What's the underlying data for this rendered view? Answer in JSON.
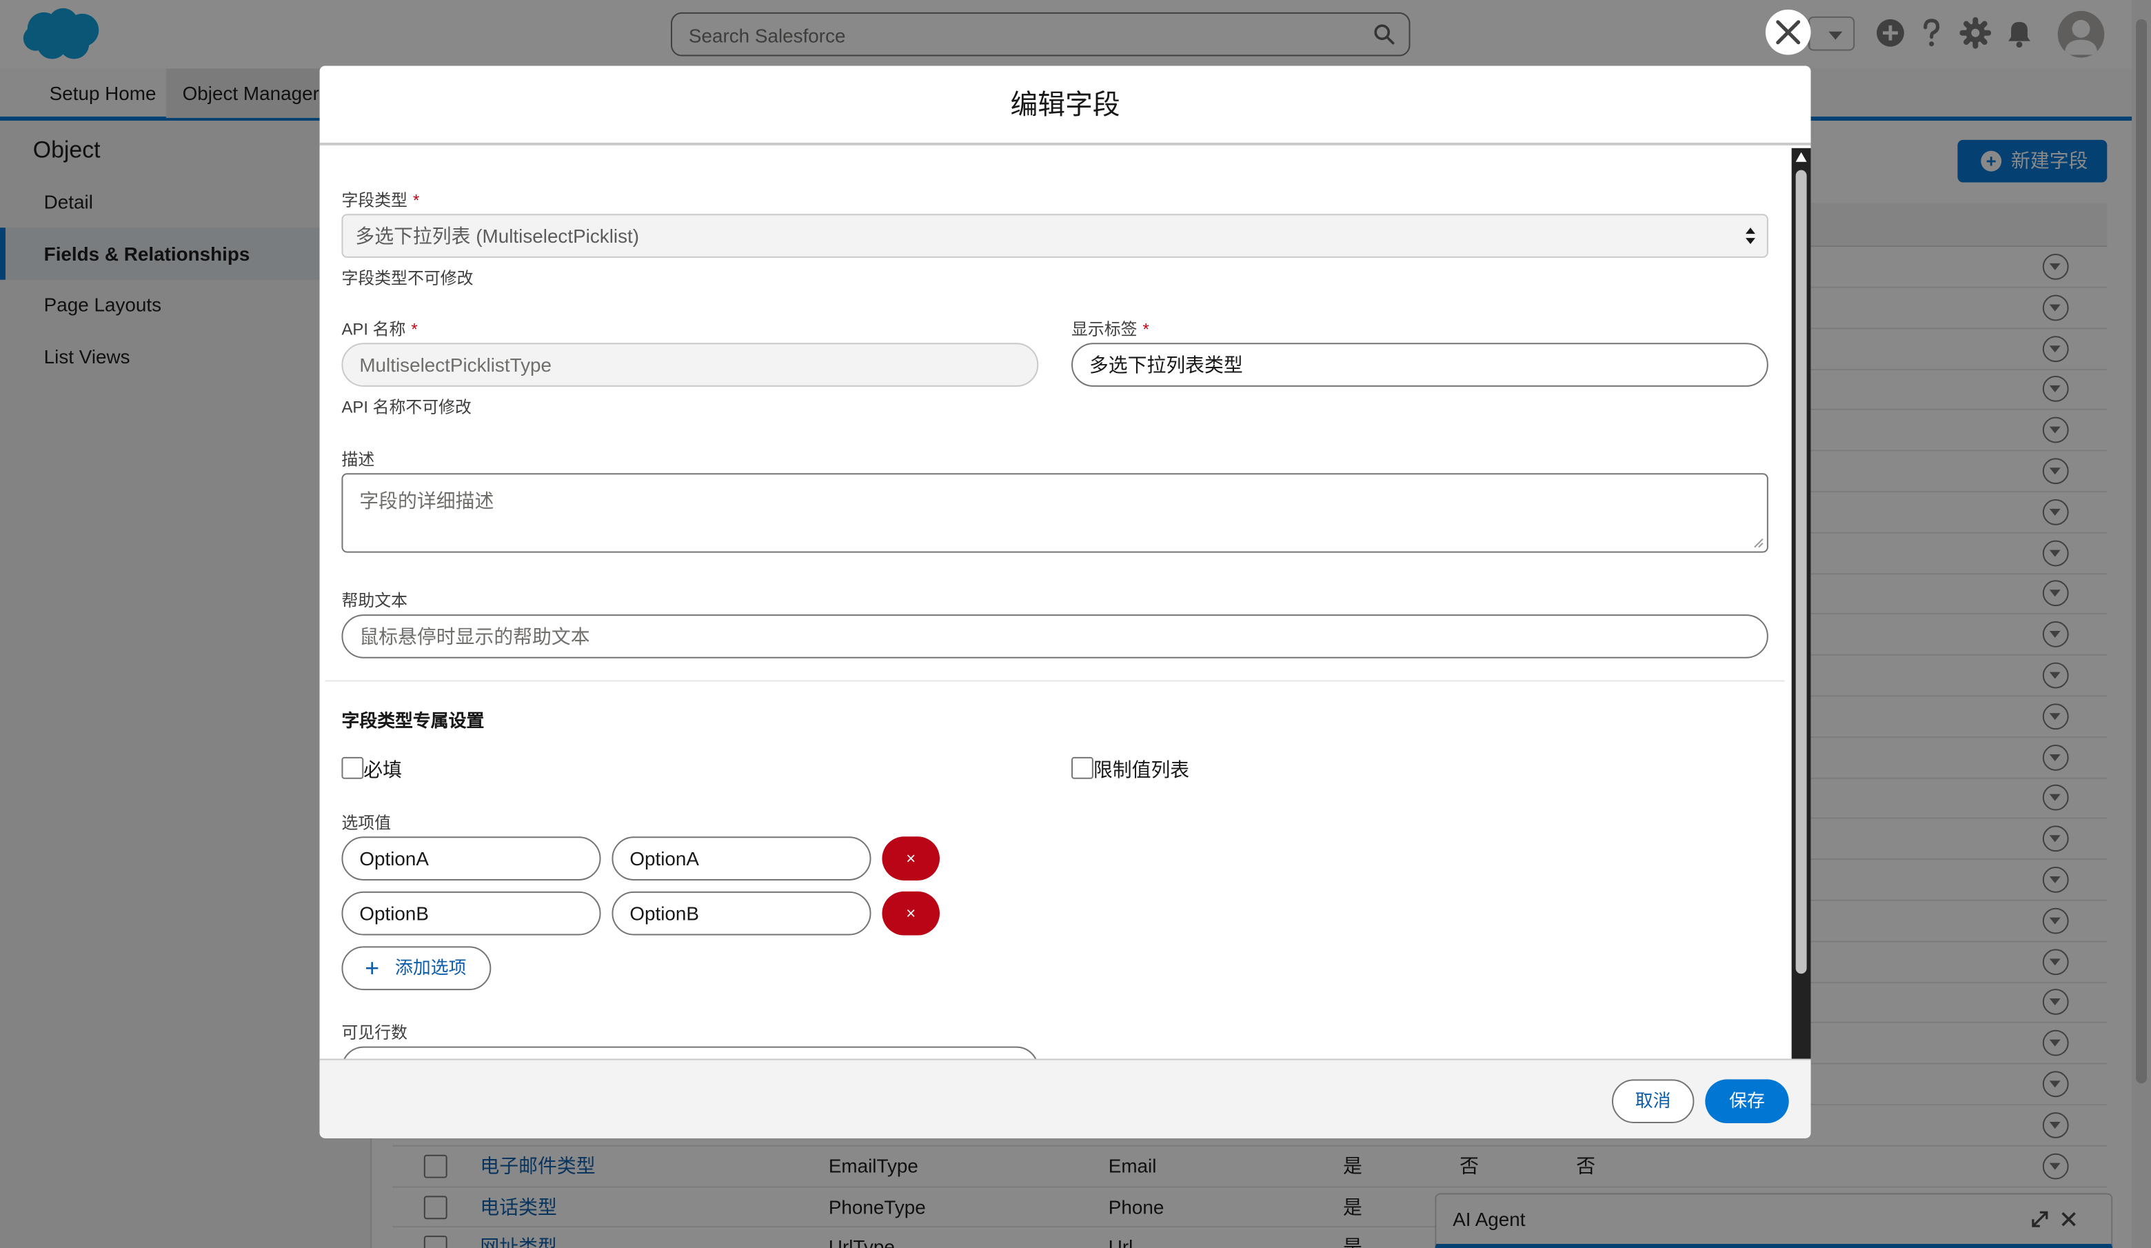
{
  "header": {
    "search_placeholder": "Search Salesforce"
  },
  "nav": {
    "tabs": [
      "Setup Home",
      "Object Manager"
    ]
  },
  "sidebar": {
    "title": "Object",
    "items": [
      "Detail",
      "Fields & Relationships",
      "Page Layouts",
      "List Views"
    ],
    "active": "Fields & Relationships"
  },
  "main": {
    "new_field_button": "新建字段",
    "rows": [
      {
        "label": "电子邮件类型",
        "api": "EmailType",
        "type": "Email",
        "c1": "是",
        "c2": "否",
        "c3": "否"
      },
      {
        "label": "电话类型",
        "api": "PhoneType",
        "type": "Phone",
        "c1": "是",
        "c2": "",
        "c3": ""
      },
      {
        "label": "网址类型",
        "api": "UrlType",
        "type": "Url",
        "c1": "是",
        "c2": "",
        "c3": ""
      }
    ]
  },
  "agent": {
    "title": "AI Agent"
  },
  "modal": {
    "title": "编辑字段",
    "field_type_label": "字段类型",
    "field_type_value": "多选下拉列表 (MultiselectPicklist)",
    "field_type_help": "字段类型不可修改",
    "api_name_label": "API 名称",
    "api_name_value": "MultiselectPicklistType",
    "api_name_help": "API 名称不可修改",
    "display_label_label": "显示标签",
    "display_label_value": "多选下拉列表类型",
    "description_label": "描述",
    "description_placeholder": "字段的详细描述",
    "help_text_label": "帮助文本",
    "help_text_placeholder": "鼠标悬停时显示的帮助文本",
    "section_title": "字段类型专属设置",
    "required_label": "必填",
    "required_checked": false,
    "restrict_label": "限制值列表",
    "restrict_checked": false,
    "options_label": "选项值",
    "options": [
      {
        "value": "OptionA",
        "label": "OptionA",
        "delete": "×"
      },
      {
        "value": "OptionB",
        "label": "OptionB",
        "delete": "×"
      }
    ],
    "add_option_label": "添加选项",
    "visible_lines_label": "可见行数",
    "cancel_label": "取消",
    "save_label": "保存"
  },
  "colors": {
    "brand": "#0176d3",
    "danger": "#ba0517",
    "link": "#0b5cab"
  }
}
